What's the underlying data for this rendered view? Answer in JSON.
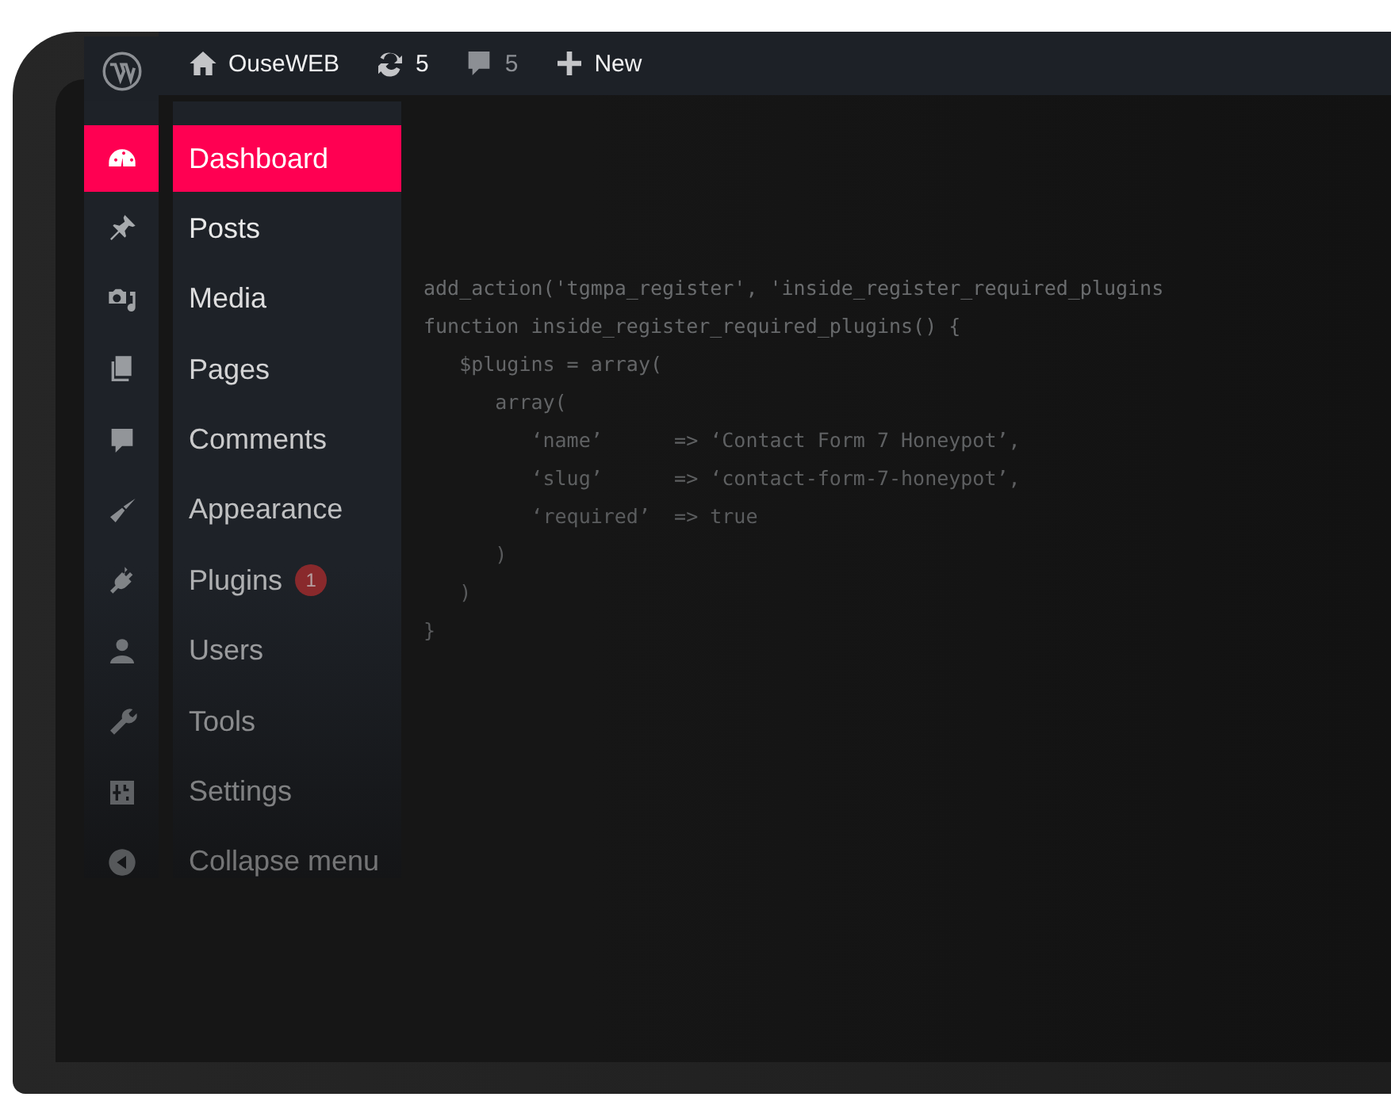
{
  "admin_bar": {
    "site": "OuseWEB",
    "updates": "5",
    "comments": "5",
    "new": "New"
  },
  "sidebar": {
    "items": [
      {
        "label": "Dashboard",
        "selected": true
      },
      {
        "label": "Posts",
        "selected": false
      },
      {
        "label": "Media",
        "selected": false
      },
      {
        "label": "Pages",
        "selected": false
      },
      {
        "label": "Comments",
        "selected": false
      },
      {
        "label": "Appearance",
        "selected": false
      },
      {
        "label": "Plugins",
        "selected": false,
        "badge": "1"
      },
      {
        "label": "Users",
        "selected": false
      },
      {
        "label": "Tools",
        "selected": false
      },
      {
        "label": "Settings",
        "selected": false
      },
      {
        "label": "Collapse menu",
        "selected": false
      }
    ]
  },
  "code": {
    "lines": [
      {
        "text": "add_action('tgmpa_register', 'inside_register_required_plugins"
      },
      {
        "text": "function inside_register_required_plugins() {"
      },
      {
        "text": "   $plugins = array("
      },
      {
        "text": "      array("
      },
      {
        "text": "         ‘name’      => ‘Contact Form 7 Honeypot’,"
      },
      {
        "text": "         ‘slug’      => ‘contact-form-7-honeypot’,"
      },
      {
        "text": "         ‘required’  => true"
      },
      {
        "text": "      )"
      },
      {
        "text": "   )"
      },
      {
        "text": "}"
      }
    ]
  }
}
